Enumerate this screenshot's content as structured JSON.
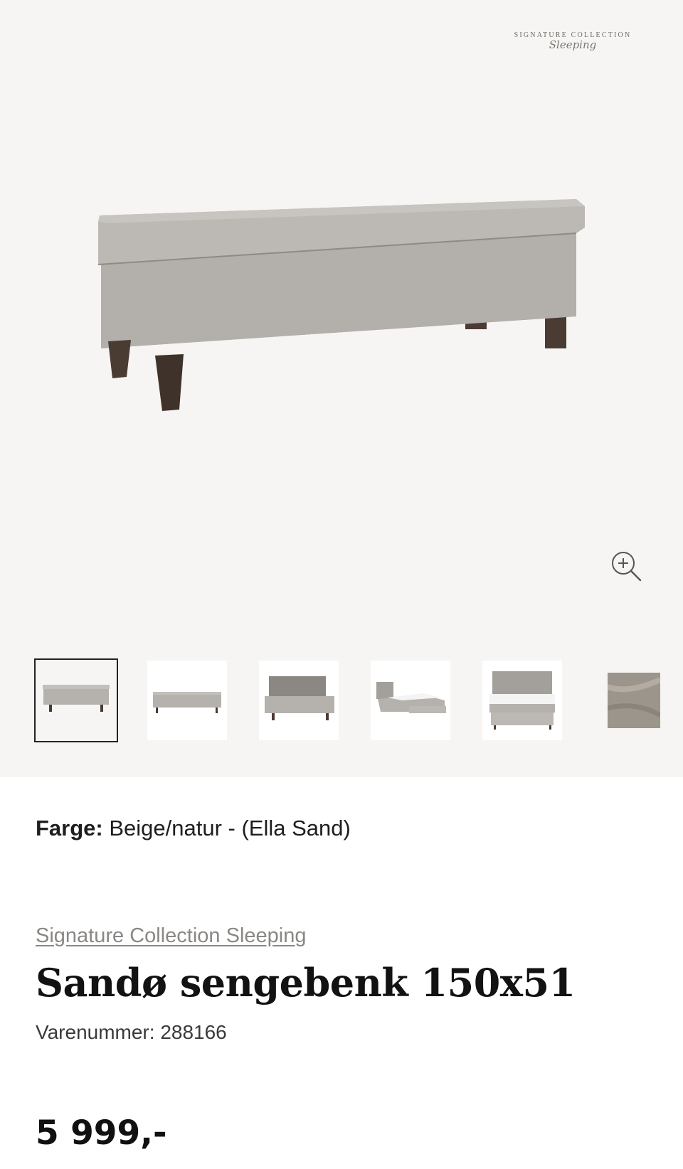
{
  "gallery": {
    "brand_logo": {
      "line1": "SIGNATURE COLLECTION",
      "line2": "Sleeping"
    },
    "main_image_alt": "Sandø sengebenk 150x51",
    "zoom_icon": "zoom-in-icon",
    "thumbnails": [
      {
        "name": "bench-front",
        "active": true
      },
      {
        "name": "bench-side",
        "active": false
      },
      {
        "name": "bench-open-lid",
        "active": false
      },
      {
        "name": "bench-with-bed-angle",
        "active": false
      },
      {
        "name": "bench-with-bed-front",
        "active": false
      },
      {
        "name": "fabric-swatch",
        "active": false
      }
    ]
  },
  "product": {
    "color_label": "Farge:",
    "color_value": "Beige/natur - (Ella Sand)",
    "brand": "Signature Collection Sleeping",
    "title": "Sandø sengebenk 150x51",
    "sku": "Varenummer: 288166",
    "price": "5 999,-"
  },
  "colors": {
    "gallery_bg": "#f6f5f3",
    "fabric": "#b5b1ac",
    "legs": "#4a3b33"
  }
}
